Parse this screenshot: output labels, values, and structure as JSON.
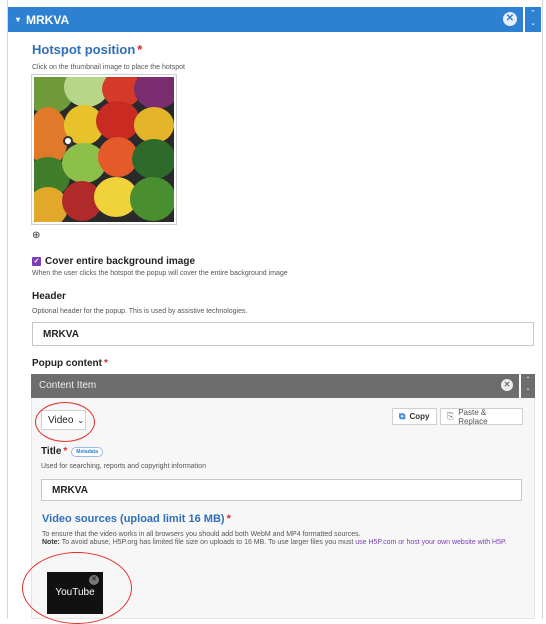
{
  "topbar": {
    "title": "MRKVA",
    "caret": "▾",
    "close_glyph": "✕",
    "arrows": "^\n⌄"
  },
  "hotspot": {
    "title": "Hotspot position",
    "required": "*",
    "description": "Click on the thumbnail image to place the hotspot",
    "zoom_icon": "⊕"
  },
  "cover": {
    "label": "Cover entire background image",
    "checked": true,
    "description": "When the user clicks the hotspot the popup will cover the entire background image"
  },
  "header_field": {
    "label": "Header",
    "description": "Optional header for the popup. This is used by assistive technologies.",
    "value": "MRKVA"
  },
  "popup": {
    "label": "Popup content",
    "required": "*"
  },
  "content_item": {
    "bar_title": "Content Item",
    "close_glyph": "✕",
    "select_value": "Video",
    "copy_label": "Copy",
    "paste_label": "Paste & Replace"
  },
  "title_field": {
    "label": "Title",
    "required": "*",
    "metadata_label": "Metadata",
    "description": "Used for searching, reports and copyright information",
    "value": "MRKVA"
  },
  "video_sources": {
    "title": "Video sources (upload limit 16 MB)",
    "required": "*",
    "line1": "To ensure that the video works in all browsers you should add both WebM and MP4 formatted sources.",
    "note_label": "Note:",
    "line2": " To avoid abuse, H5P.org has limited file size on uploads to 16 MB. To use larger files you must ",
    "link": "use H5P.com or host your own website with H5P.",
    "tile_label": "YouTube"
  },
  "colors": {
    "accent": "#2e80d3",
    "heading": "#2f6fb8",
    "required": "#d42c2c",
    "annotation": "#e0302a",
    "checkbox": "#7b3fb2",
    "content_bar": "#6d6d6d"
  }
}
